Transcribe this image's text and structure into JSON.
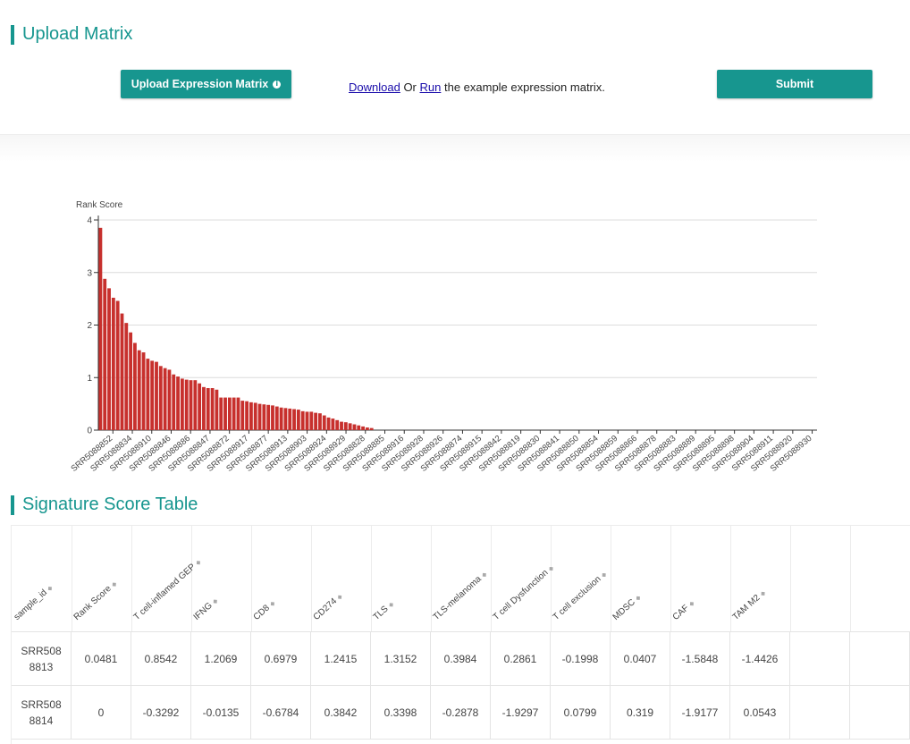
{
  "upload_section": {
    "title": "Upload Matrix",
    "upload_button_label": "Upload Expression Matrix",
    "info_glyph": "i",
    "download_link": "Download",
    "or_text": " Or ",
    "run_link": "Run",
    "example_text": " the example expression matrix.",
    "submit_label": "Submit"
  },
  "chart_data": {
    "type": "bar",
    "ylabel": "Rank Score",
    "ylim": [
      0,
      4
    ],
    "yticks": [
      0,
      1,
      2,
      3,
      4
    ],
    "bar_color": "#c7302d",
    "labeled_categories": [
      "SRR5088852",
      "SRR5088834",
      "SRR5088910",
      "SRR5088846",
      "SRR5088886",
      "SRR5088847",
      "SRR5088872",
      "SRR5088917",
      "SRR5088877",
      "SRR5088913",
      "SRR5088903",
      "SRR5088924",
      "SRR5088929",
      "SRR5088828",
      "SRR5088885",
      "SRR5088916",
      "SRR5088928",
      "SRR5088926",
      "SRR5088874",
      "SRR5088915",
      "SRR5088842",
      "SRR5088819",
      "SRR5088830",
      "SRR5088841",
      "SRR5088850",
      "SRR5088854",
      "SRR5088859",
      "SRR5088866",
      "SRR5088878",
      "SRR5088883",
      "SRR5088889",
      "SRR5088895",
      "SRR5088898",
      "SRR5088904",
      "SRR5088911",
      "SRR5088920",
      "SRR5088930"
    ],
    "values": [
      3.85,
      2.88,
      2.7,
      2.52,
      2.46,
      2.22,
      2.04,
      1.86,
      1.66,
      1.52,
      1.48,
      1.36,
      1.32,
      1.3,
      1.22,
      1.18,
      1.15,
      1.06,
      1.02,
      0.98,
      0.96,
      0.95,
      0.95,
      0.89,
      0.82,
      0.8,
      0.8,
      0.77,
      0.62,
      0.62,
      0.62,
      0.62,
      0.62,
      0.56,
      0.55,
      0.53,
      0.52,
      0.5,
      0.49,
      0.48,
      0.47,
      0.45,
      0.43,
      0.42,
      0.41,
      0.4,
      0.39,
      0.36,
      0.35,
      0.35,
      0.33,
      0.32,
      0.28,
      0.24,
      0.22,
      0.19,
      0.16,
      0.15,
      0.13,
      0.11,
      0.09,
      0.07,
      0.05,
      0.04,
      0,
      0,
      0,
      0,
      0,
      0,
      0,
      0,
      0,
      0,
      0,
      0,
      0,
      0,
      0,
      0,
      0,
      0,
      0,
      0,
      0,
      0,
      0,
      0,
      0,
      0,
      0,
      0,
      0,
      0,
      0,
      0,
      0,
      0,
      0,
      0,
      0,
      0,
      0,
      0,
      0,
      0,
      0,
      0,
      0,
      0,
      0,
      0,
      0,
      0,
      0,
      0,
      0,
      0,
      0,
      0,
      0,
      0,
      0,
      0,
      0,
      0,
      0,
      0,
      0,
      0,
      0,
      0,
      0,
      0,
      0,
      0,
      0,
      0,
      0,
      0,
      0,
      0,
      0,
      0,
      0,
      0,
      0,
      0,
      0,
      0,
      0,
      0,
      0,
      0,
      0,
      0,
      0,
      0,
      0,
      0,
      0,
      0,
      0,
      0,
      0,
      0,
      0
    ]
  },
  "table_section": {
    "title": "Signature Score Table",
    "sort_glyph": "◆",
    "columns": [
      "sample_id",
      "Rank Score",
      "T cell-inflamed GEP",
      "IFNG",
      "CD8",
      "CD274",
      "TLS",
      "TLS-melanoma",
      "T cell Dysfunction",
      "T cell exclusion",
      "MDSC",
      "CAF",
      "TAM M2",
      "",
      ""
    ],
    "rows": [
      [
        "SRR508\n8813",
        "0.0481",
        "0.8542",
        "1.2069",
        "0.6979",
        "1.2415",
        "1.3152",
        "0.3984",
        "0.2861",
        "-0.1998",
        "0.0407",
        "-1.5848",
        "-1.4426",
        "",
        ""
      ],
      [
        "SRR508\n8814",
        "0",
        "-0.3292",
        "-0.0135",
        "-0.6784",
        "0.3842",
        "0.3398",
        "-0.2878",
        "-1.9297",
        "0.0799",
        "0.319",
        "-1.9177",
        "0.0543",
        "",
        ""
      ]
    ]
  }
}
